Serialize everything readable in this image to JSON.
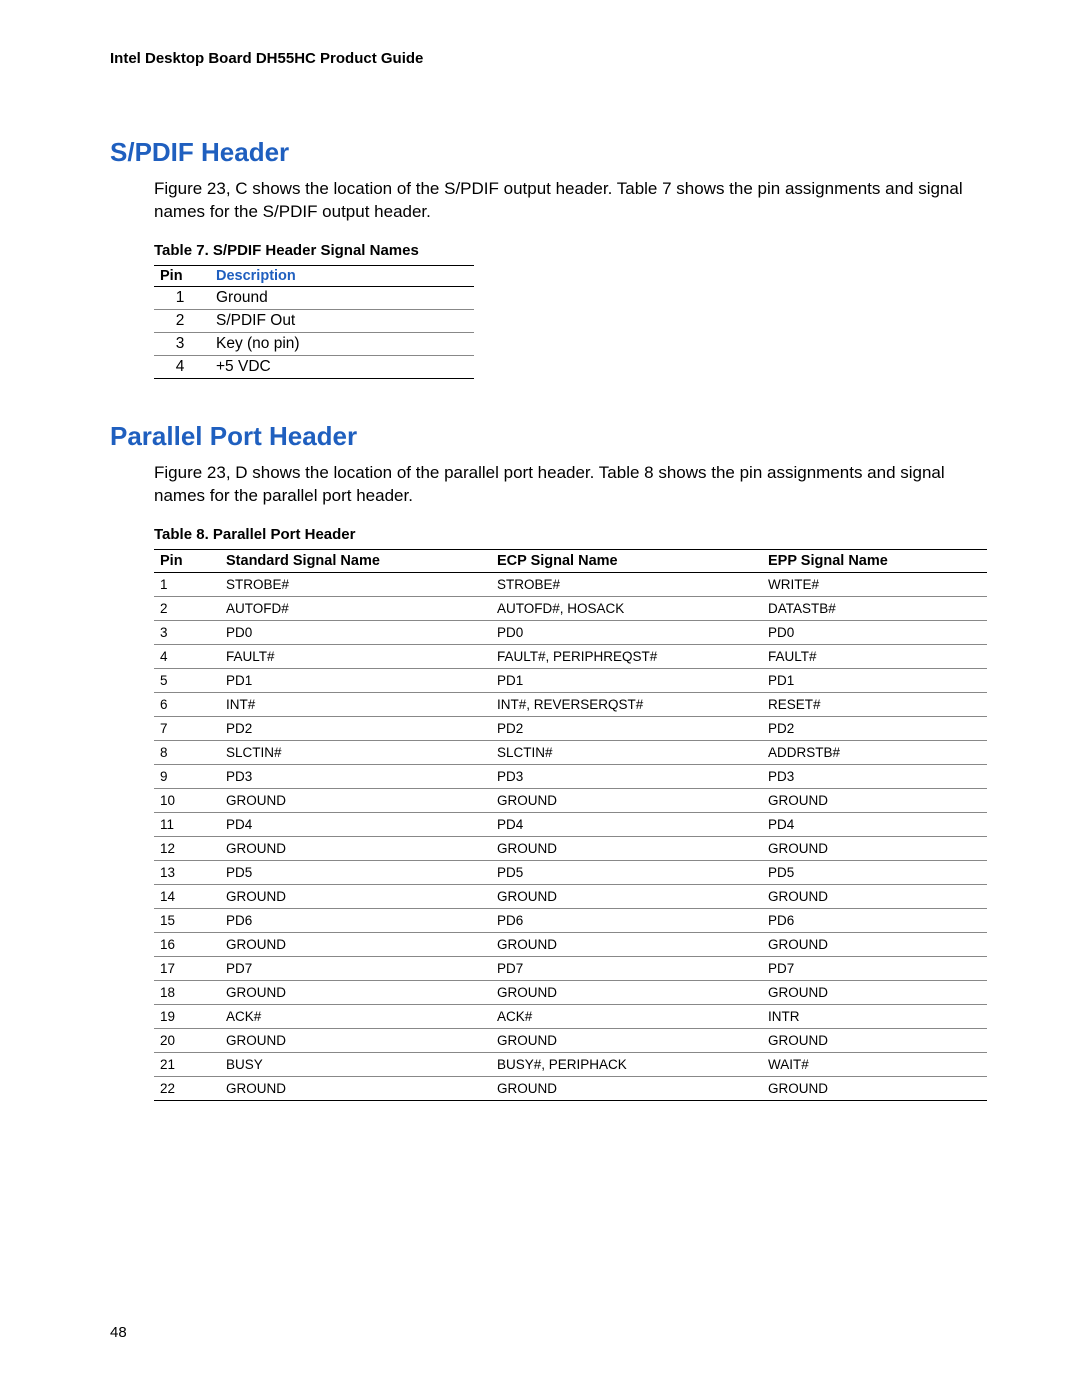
{
  "header": "Intel Desktop Board DH55HC Product Guide",
  "page_number": "48",
  "section1": {
    "heading": "S/PDIF Header",
    "body": "Figure 23, C shows the location of the S/PDIF output header.  Table 7 shows the pin assignments and signal names for the S/PDIF output header.",
    "table_caption": "Table 7.  S/PDIF Header Signal Names",
    "table": {
      "headers": {
        "pin": "Pin",
        "desc": "Description"
      },
      "rows": [
        {
          "pin": "1",
          "desc": "Ground"
        },
        {
          "pin": "2",
          "desc": "S/PDIF Out"
        },
        {
          "pin": "3",
          "desc": "Key (no pin)"
        },
        {
          "pin": "4",
          "desc": "+5 VDC"
        }
      ]
    }
  },
  "section2": {
    "heading": "Parallel Port Header",
    "body": "Figure 23, D shows the location of the parallel port header.  Table 8 shows the pin assignments and signal names for the parallel port header.",
    "table_caption": "Table 8.  Parallel Port Header",
    "table": {
      "headers": {
        "pin": "Pin",
        "std": "Standard Signal Name",
        "ecp": "ECP Signal Name",
        "epp": "EPP Signal Name"
      },
      "rows": [
        {
          "pin": "1",
          "std": "STROBE#",
          "ecp": "STROBE#",
          "epp": "WRITE#"
        },
        {
          "pin": "2",
          "std": "AUTOFD#",
          "ecp": "AUTOFD#, HOSACK",
          "epp": "DATASTB#"
        },
        {
          "pin": "3",
          "std": "PD0",
          "ecp": "PD0",
          "epp": "PD0"
        },
        {
          "pin": "4",
          "std": "FAULT#",
          "ecp": "FAULT#, PERIPHREQST#",
          "epp": "FAULT#"
        },
        {
          "pin": "5",
          "std": "PD1",
          "ecp": "PD1",
          "epp": "PD1"
        },
        {
          "pin": "6",
          "std": "INT#",
          "ecp": "INT#, REVERSERQST#",
          "epp": "RESET#"
        },
        {
          "pin": "7",
          "std": "PD2",
          "ecp": "PD2",
          "epp": "PD2"
        },
        {
          "pin": "8",
          "std": "SLCTIN#",
          "ecp": "SLCTIN#",
          "epp": "ADDRSTB#"
        },
        {
          "pin": "9",
          "std": "PD3",
          "ecp": "PD3",
          "epp": "PD3"
        },
        {
          "pin": "10",
          "std": "GROUND",
          "ecp": "GROUND",
          "epp": "GROUND"
        },
        {
          "pin": "11",
          "std": "PD4",
          "ecp": "PD4",
          "epp": "PD4"
        },
        {
          "pin": "12",
          "std": "GROUND",
          "ecp": "GROUND",
          "epp": "GROUND"
        },
        {
          "pin": "13",
          "std": "PD5",
          "ecp": "PD5",
          "epp": "PD5"
        },
        {
          "pin": "14",
          "std": "GROUND",
          "ecp": "GROUND",
          "epp": "GROUND"
        },
        {
          "pin": "15",
          "std": "PD6",
          "ecp": "PD6",
          "epp": "PD6"
        },
        {
          "pin": "16",
          "std": "GROUND",
          "ecp": "GROUND",
          "epp": "GROUND"
        },
        {
          "pin": "17",
          "std": "PD7",
          "ecp": "PD7",
          "epp": "PD7"
        },
        {
          "pin": "18",
          "std": "GROUND",
          "ecp": "GROUND",
          "epp": "GROUND"
        },
        {
          "pin": "19",
          "std": "ACK#",
          "ecp": "ACK#",
          "epp": "INTR"
        },
        {
          "pin": "20",
          "std": "GROUND",
          "ecp": "GROUND",
          "epp": "GROUND"
        },
        {
          "pin": "21",
          "std": "BUSY",
          "ecp": "BUSY#, PERIPHACK",
          "epp": "WAIT#"
        },
        {
          "pin": "22",
          "std": "GROUND",
          "ecp": "GROUND",
          "epp": "GROUND"
        }
      ]
    }
  }
}
